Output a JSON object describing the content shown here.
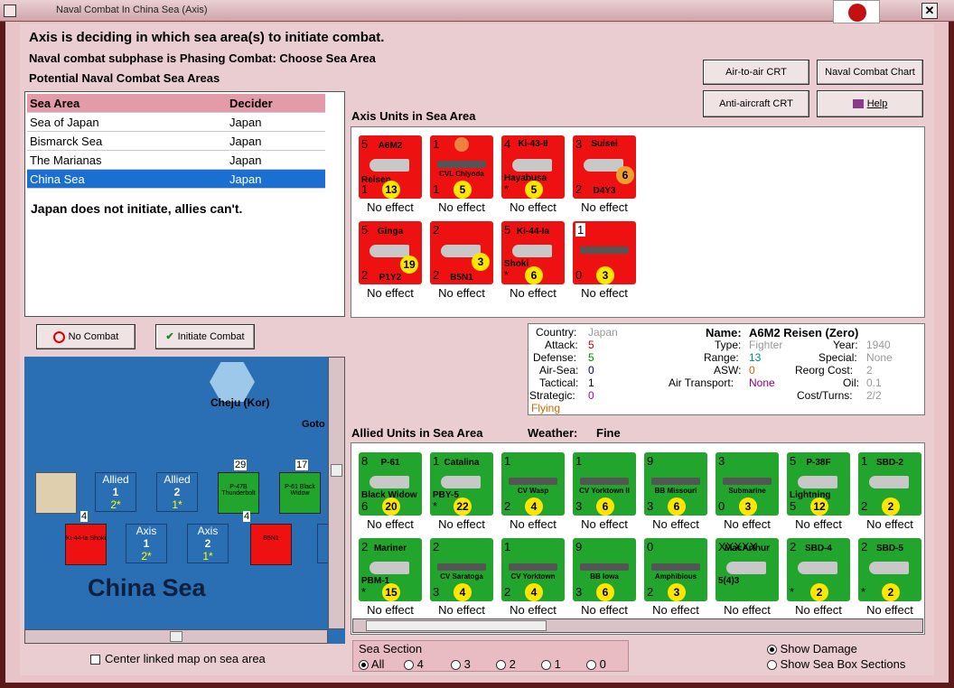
{
  "window": {
    "title": "Naval Combat In China Sea (Axis)",
    "close": "✕"
  },
  "status": {
    "line1": "Axis is deciding in which sea area(s) to initiate combat.",
    "line2": "Naval combat subphase is Phasing Combat: Choose Sea Area",
    "line3": "Potential Naval Combat Sea Areas"
  },
  "table": {
    "headers": [
      "Sea Area",
      "Decider"
    ],
    "rows": [
      {
        "area": "Sea of Japan",
        "decider": "Japan"
      },
      {
        "area": "Bismarck Sea",
        "decider": "Japan"
      },
      {
        "area": "The Marianas",
        "decider": "Japan"
      },
      {
        "area": "China Sea",
        "decider": "Japan"
      }
    ],
    "note": "Japan does not initiate, allies can't."
  },
  "buttons": {
    "air_to_air": "Air-to-air CRT",
    "naval_combat_chart": "Naval Combat Chart",
    "anti_aircraft": "Anti-aircraft CRT",
    "help": "Help",
    "no_combat": "No Combat",
    "initiate_combat": "Initiate Combat"
  },
  "axis_panel": {
    "title": "Axis Units in Sea Area",
    "units": [
      {
        "name": "A6M2",
        "sub": "Reisen",
        "tl": "5",
        "bl": "1",
        "mid": "13",
        "effect": "No effect"
      },
      {
        "name": "CVL Chiyoda",
        "sub": "",
        "tl": "1",
        "bl": "1",
        "mid": "5",
        "effect": "No effect"
      },
      {
        "name": "Ki-43-II",
        "sub": "Hayabusa",
        "tl": "4",
        "bl": "*",
        "mid": "5",
        "effect": "No effect"
      },
      {
        "name": "Suisei",
        "sub": "D4Y3",
        "tl": "3",
        "bl": "2",
        "mid": "6",
        "effect": "No effect"
      },
      {
        "name": "Ginga",
        "sub": "P1Y2",
        "tl": "5",
        "bl": "2",
        "mid": "19",
        "effect": "No effect"
      },
      {
        "name": "B5N1",
        "sub": "",
        "tl": "2",
        "bl": "2",
        "mid": "3",
        "effect": "No effect"
      },
      {
        "name": "Ki-44-Ia",
        "sub": "Shoki",
        "tl": "5",
        "bl": "*",
        "mid": "6",
        "effect": "No effect"
      },
      {
        "name": "",
        "sub": "",
        "tl": "1",
        "bl": "0",
        "mid": "3",
        "effect": "No effect"
      }
    ]
  },
  "unit_info": {
    "country_label": "Country:",
    "country": "Japan",
    "attack_label": "Attack:",
    "attack": "5",
    "defense_label": "Defense:",
    "defense": "5",
    "airsea_label": "Air-Sea:",
    "airsea": "0",
    "tactical_label": "Tactical:",
    "tactical": "1",
    "strategic_label": "Strategic:",
    "strategic": "0",
    "flying": "Flying",
    "name_label": "Name:",
    "name": "A6M2 Reisen (Zero)",
    "type_label": "Type:",
    "type": "Fighter",
    "range_label": "Range:",
    "range": "13",
    "asw_label": "ASW:",
    "asw": "0",
    "air_transport_label": "Air Transport:",
    "air_transport": "None",
    "year_label": "Year:",
    "year": "1940",
    "special_label": "Special:",
    "special": "None",
    "reorg_label": "Reorg Cost:",
    "reorg": "2",
    "oil_label": "Oil:",
    "oil": "0.1",
    "cost_label": "Cost/Turns:",
    "cost": "2/2"
  },
  "allied_panel": {
    "title": "Allied Units in Sea Area",
    "weather_label": "Weather:",
    "weather": "Fine",
    "units": [
      {
        "name": "P-61",
        "sub": "Black Widow",
        "tl": "8",
        "bl": "6",
        "mid": "20",
        "effect": "No effect"
      },
      {
        "name": "Catalina",
        "sub": "PBY-5",
        "tl": "1",
        "bl": "*",
        "mid": "22",
        "effect": "No effect"
      },
      {
        "name": "CV Wasp",
        "sub": "",
        "tl": "1",
        "bl": "2",
        "mid": "4",
        "effect": "No effect"
      },
      {
        "name": "CV Yorktown II",
        "sub": "",
        "tl": "1",
        "bl": "3",
        "mid": "6",
        "effect": "No effect"
      },
      {
        "name": "BB Missouri",
        "sub": "",
        "tl": "9",
        "bl": "3",
        "mid": "6",
        "effect": "No effect"
      },
      {
        "name": "Submarine",
        "sub": "",
        "tl": "3",
        "bl": "0",
        "mid": "3",
        "effect": "No effect"
      },
      {
        "name": "P-38F",
        "sub": "Lightning",
        "tl": "5",
        "bl": "5",
        "mid": "12",
        "effect": "No effect"
      },
      {
        "name": "SBD-2",
        "sub": "",
        "tl": "1",
        "bl": "2",
        "mid": "2",
        "effect": "No effect"
      },
      {
        "name": "Mariner",
        "sub": "PBM-1",
        "tl": "2",
        "bl": "*",
        "mid": "15",
        "effect": "No effect"
      },
      {
        "name": "CV Saratoga",
        "sub": "",
        "tl": "2",
        "bl": "3",
        "mid": "4",
        "effect": "No effect"
      },
      {
        "name": "CV Yorktown",
        "sub": "",
        "tl": "1",
        "bl": "2",
        "mid": "4",
        "effect": "No effect"
      },
      {
        "name": "BB Iowa",
        "sub": "",
        "tl": "9",
        "bl": "3",
        "mid": "6",
        "effect": "No effect"
      },
      {
        "name": "Amphibious",
        "sub": "",
        "tl": "0",
        "bl": "2",
        "mid": "3",
        "effect": "No effect"
      },
      {
        "name": "MacArthur",
        "sub": "5(4)3",
        "tl": "XXXXX",
        "bl": "",
        "mid": "",
        "effect": "No effect"
      },
      {
        "name": "SBD-4",
        "sub": "",
        "tl": "2",
        "bl": "*",
        "mid": "2",
        "effect": "No effect"
      },
      {
        "name": "SBD-5",
        "sub": "",
        "tl": "2",
        "bl": "*",
        "mid": "2",
        "effect": "No effect"
      }
    ]
  },
  "map": {
    "port": "Cheju (Kor)",
    "goto": "Goto",
    "sea_name": "China Sea",
    "boxes": [
      {
        "label": "Allied",
        "num": "1",
        "sub": "2*"
      },
      {
        "label": "Allied",
        "num": "2",
        "sub": "1*"
      },
      {
        "label": "Axis",
        "num": "1",
        "sub": "2*"
      },
      {
        "label": "Axis",
        "num": "2",
        "sub": "1*"
      }
    ],
    "stack_counts": [
      "29",
      "17",
      "4",
      "4"
    ],
    "stack_names": [
      "P-47B Thunderbolt",
      "P-61 Black Widow",
      "Ki-44-Ia Shoki",
      "B5N1"
    ]
  },
  "options": {
    "center_map": "Center linked map on sea area",
    "sea_section_label": "Sea Section",
    "sections": [
      "All",
      "4",
      "3",
      "2",
      "1",
      "0"
    ],
    "show_damage": "Show Damage",
    "show_sections": "Show Sea Box Sections"
  },
  "colors": {
    "axis": "#ee1111",
    "allied": "#21a52c",
    "selection": "#1a6fd0"
  }
}
